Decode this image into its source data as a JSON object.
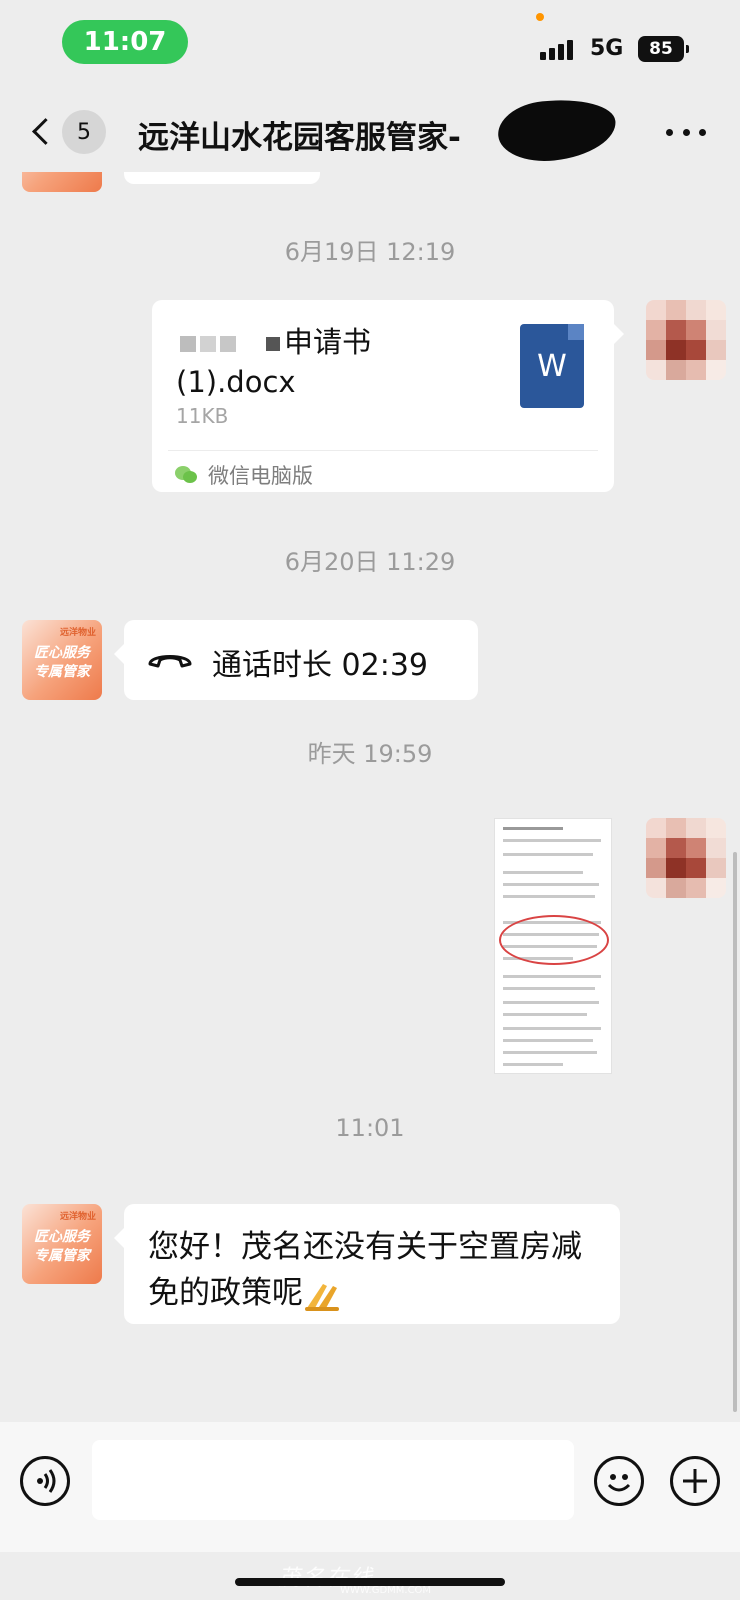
{
  "status_bar": {
    "time": "11:07",
    "network": "5G",
    "battery": "85"
  },
  "nav": {
    "unread_count": "5",
    "title": "远洋山水花园客服管家-"
  },
  "messages": {
    "ts1": "6月19日 12:19",
    "file": {
      "name_part": "申请书",
      "name_ext": "(1).docx",
      "size": "11KB",
      "source": "微信电脑版",
      "icon_letter": "W"
    },
    "ts2": "6月20日 11:29",
    "call": {
      "text": "通话时长 02:39"
    },
    "ts3": "昨天 19:59",
    "ts4": "11:01",
    "reply": {
      "text": "您好！茂名还没有关于空置房减免的政策呢"
    }
  },
  "agent_avatar": {
    "line1": "匠心服务",
    "line2": "专属管家",
    "tag": "远洋物业"
  },
  "watermark": {
    "text": "茂名在线",
    "url": "WWW.GDMM.COM"
  },
  "colors": {
    "background": "#ededed",
    "bubble": "#ffffff",
    "time_pill": "#34c759",
    "word_icon": "#2b579a"
  }
}
